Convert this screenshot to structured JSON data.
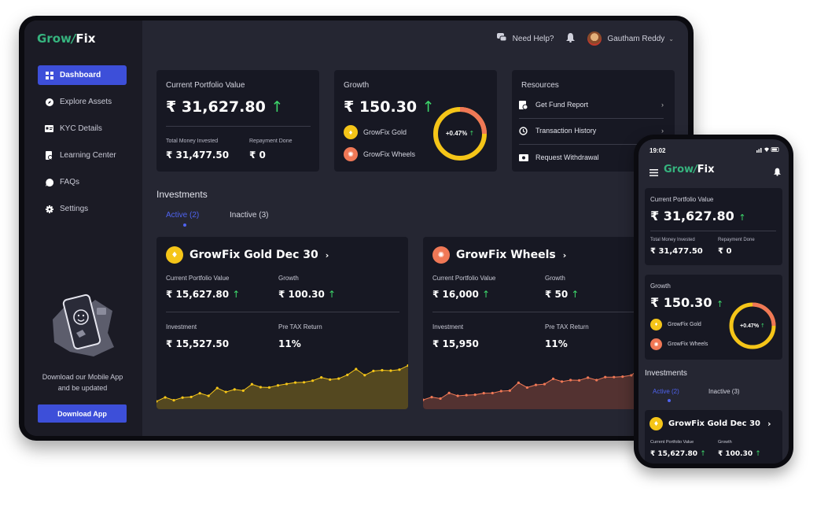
{
  "brand": {
    "grow": "Grow",
    "fix": "Fix"
  },
  "sidebar": {
    "items": [
      {
        "label": "Dashboard",
        "icon": "grid-icon"
      },
      {
        "label": "Explore Assets",
        "icon": "compass-icon"
      },
      {
        "label": "KYC Details",
        "icon": "id-card-icon"
      },
      {
        "label": "Learning Center",
        "icon": "book-icon"
      },
      {
        "label": "FAQs",
        "icon": "chat-icon"
      },
      {
        "label": "Settings",
        "icon": "gear-icon"
      }
    ],
    "promo_text": "Download our Mobile App and be updated",
    "download_label": "Download App"
  },
  "topbar": {
    "help_label": "Need Help?",
    "user_name": "Gautham Reddy"
  },
  "portfolio": {
    "title": "Current Portfolio Value",
    "value": "₹ 31,627.80",
    "invested_label": "Total Money Invested",
    "invested_value": "₹ 31,477.50",
    "repayment_label": "Repayment Done",
    "repayment_value": "₹ 0"
  },
  "growth": {
    "title": "Growth",
    "value": "₹ 150.30",
    "percent": "+0.47%",
    "legend": [
      "GrowFix Gold",
      "GrowFix Wheels"
    ]
  },
  "resources": {
    "title": "Resources",
    "items": [
      {
        "label": "Get Fund Report",
        "icon": "report-icon"
      },
      {
        "label": "Transaction History",
        "icon": "history-icon"
      },
      {
        "label": "Request Withdrawal",
        "icon": "cash-icon"
      }
    ]
  },
  "investments": {
    "title": "Investments",
    "tabs": [
      "Active (2)",
      "Inactive (3)"
    ],
    "cards": [
      {
        "name": "GrowFix Gold Dec 30",
        "current_label": "Current Portfolio Value",
        "current_value": "₹ 15,627.80",
        "growth_label": "Growth",
        "growth_value": "₹ 100.30",
        "investment_label": "Investment",
        "investment_value": "₹ 15,527.50",
        "return_label": "Pre TAX Return",
        "return_value": "11%",
        "color": "#f5c518"
      },
      {
        "name": "GrowFix Wheels",
        "current_label": "Current Portfolio Value",
        "current_value": "₹ 16,000",
        "growth_label": "Growth",
        "growth_value": "₹ 50",
        "investment_label": "Investment",
        "investment_value": "₹ 15,950",
        "return_label": "Pre TAX Return",
        "return_value": "11%",
        "color": "#f07856"
      }
    ]
  },
  "phone": {
    "time": "19:02"
  },
  "up_arrow": "↑",
  "chevron": "›"
}
